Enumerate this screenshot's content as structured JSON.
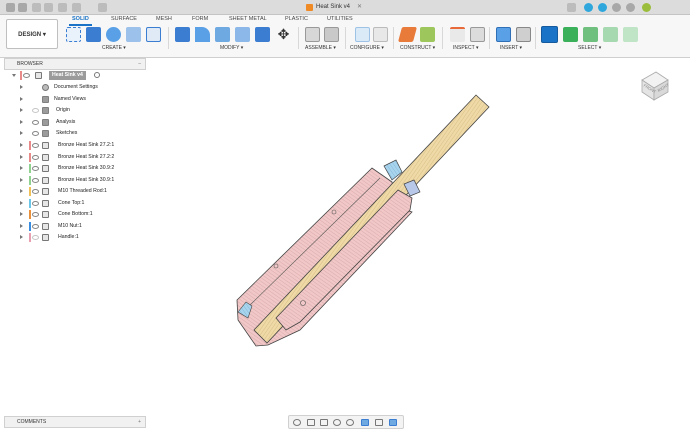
{
  "titlebar": {
    "document_title": "Heat Sink v4"
  },
  "workspace": {
    "label": "DESIGN"
  },
  "tabs": [
    {
      "label": "SOLID",
      "active": true
    },
    {
      "label": "SURFACE"
    },
    {
      "label": "MESH"
    },
    {
      "label": "FORM"
    },
    {
      "label": "SHEET METAL"
    },
    {
      "label": "PLASTIC"
    },
    {
      "label": "UTILITIES"
    }
  ],
  "groups": [
    "CREATE ▾",
    "MODIFY ▾",
    "ASSEMBLE ▾",
    "CONFIGURE ▾",
    "CONSTRUCT ▾",
    "INSPECT ▾",
    "INSERT ▾",
    "SELECT ▾"
  ],
  "browser": {
    "header": "BROWSER",
    "root": "Heat Sink v4",
    "items": [
      {
        "label": "Document Settings",
        "icon": "gear-icon"
      },
      {
        "label": "Named Views",
        "icon": "folder-icon"
      },
      {
        "label": "Origin",
        "icon": "folder-icon"
      },
      {
        "label": "Analysis",
        "icon": "folder-icon"
      },
      {
        "label": "Sketches",
        "icon": "folder-icon"
      },
      {
        "label": "Bronze Heat Sink 27.2:1",
        "color": "#e88a8a"
      },
      {
        "label": "Bronze Heat Sink 27.2:2",
        "color": "#e88a8a"
      },
      {
        "label": "Bronze Heat Sink 30.9:2",
        "color": "#8fd18f"
      },
      {
        "label": "Bronze Heat Sink 30.9:1",
        "color": "#8fd18f"
      },
      {
        "label": "M10 Threaded Rod:1",
        "color": "#f0c05a"
      },
      {
        "label": "Cone Top:1",
        "color": "#6cc6e8"
      },
      {
        "label": "Cone Bottom:1",
        "color": "#e8903c"
      },
      {
        "label": "M10 Nut:1",
        "color": "#3a8de0"
      },
      {
        "label": "Handle:1",
        "color": "#e8a0b0"
      }
    ]
  },
  "comments": {
    "label": "COMMENTS"
  },
  "viewcube": {
    "face_left": "FRONT",
    "face_right": "RIGHT"
  },
  "colors": {
    "accent": "#1a73c6",
    "rod": "#efd9a6",
    "sink": "#f1c7c7",
    "cone_top": "#a8d4ee",
    "nut": "#b8c8e8"
  }
}
